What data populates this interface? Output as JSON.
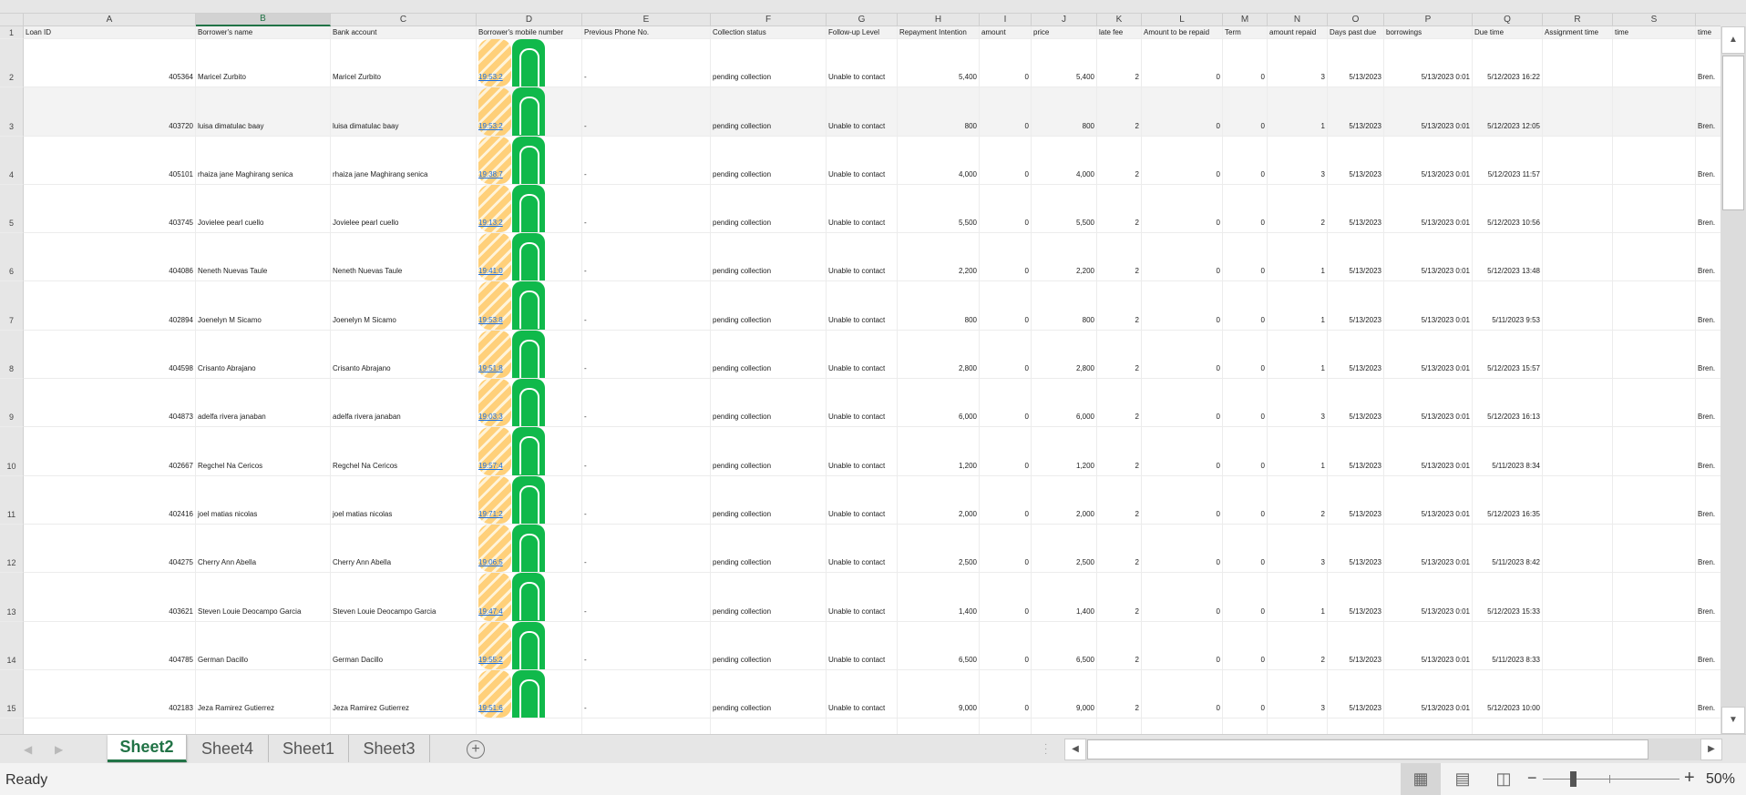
{
  "columns": [
    "A",
    "B",
    "C",
    "D",
    "E",
    "F",
    "G",
    "H",
    "I",
    "J",
    "K",
    "L",
    "M",
    "N",
    "O",
    "P",
    "Q",
    "R",
    "S",
    ""
  ],
  "selected_column": "B",
  "headers": [
    "Loan ID",
    "Borrower's name",
    "Bank account",
    "Borrower's mobile number",
    "Previous Phone No.",
    "Collection status",
    "Follow-up Level",
    "Repayment Intention",
    "amount",
    "price",
    "late fee",
    "Amount to be repaid",
    "Term",
    "amount repaid",
    "Days past due",
    "borrowings",
    "Due time",
    "Assignment time",
    "time",
    "time"
  ],
  "rows": [
    {
      "n": "2",
      "id": "405364",
      "name": "Maricel Zurbito",
      "bank": "Maricel Zurbito",
      "phone": "19:53:2",
      "prev": "-",
      "status": "pending collection",
      "follow": "Unable to contact",
      "intent": "5,400",
      "amount": "0",
      "price": "5,400",
      "late": "2",
      "tobe": "0",
      "term": "0",
      "repaid": "3",
      "dpd": "5/13/2023",
      "borrow": "5/13/2023 0:01",
      "due": "5/12/2023 16:22",
      "assign": "",
      "time": "",
      "time2": "Bren."
    },
    {
      "n": "3",
      "id": "403720",
      "name": "luisa dimatulac baay",
      "bank": "luisa dimatulac baay",
      "phone": "19:53:2",
      "prev": "-",
      "status": "pending collection",
      "follow": "Unable to contact",
      "intent": "800",
      "amount": "0",
      "price": "800",
      "late": "2",
      "tobe": "0",
      "term": "0",
      "repaid": "1",
      "dpd": "5/13/2023",
      "borrow": "5/13/2023 0:01",
      "due": "5/12/2023 12:05",
      "assign": "",
      "time": "",
      "time2": "Bren."
    },
    {
      "n": "4",
      "id": "405101",
      "name": "rhaiza jane Maghirang senica",
      "bank": "rhaiza jane Maghirang senica",
      "phone": "19:38:7",
      "prev": "-",
      "status": "pending collection",
      "follow": "Unable to contact",
      "intent": "4,000",
      "amount": "0",
      "price": "4,000",
      "late": "2",
      "tobe": "0",
      "term": "0",
      "repaid": "3",
      "dpd": "5/13/2023",
      "borrow": "5/13/2023 0:01",
      "due": "5/12/2023 11:57",
      "assign": "",
      "time": "",
      "time2": "Bren."
    },
    {
      "n": "5",
      "id": "403745",
      "name": "Jovielee pearl cuello",
      "bank": "Jovielee pearl cuello",
      "phone": "19:13:2",
      "prev": "-",
      "status": "pending collection",
      "follow": "Unable to contact",
      "intent": "5,500",
      "amount": "0",
      "price": "5,500",
      "late": "2",
      "tobe": "0",
      "term": "0",
      "repaid": "2",
      "dpd": "5/13/2023",
      "borrow": "5/13/2023 0:01",
      "due": "5/12/2023 10:56",
      "assign": "",
      "time": "",
      "time2": "Bren."
    },
    {
      "n": "6",
      "id": "404086",
      "name": "Neneth Nuevas Taule",
      "bank": "Neneth Nuevas Taule",
      "phone": "19:41:0",
      "prev": "-",
      "status": "pending collection",
      "follow": "Unable to contact",
      "intent": "2,200",
      "amount": "0",
      "price": "2,200",
      "late": "2",
      "tobe": "0",
      "term": "0",
      "repaid": "1",
      "dpd": "5/13/2023",
      "borrow": "5/13/2023 0:01",
      "due": "5/12/2023 13:48",
      "assign": "",
      "time": "",
      "time2": "Bren."
    },
    {
      "n": "7",
      "id": "402894",
      "name": "Joenelyn M Sicamo",
      "bank": "Joenelyn M Sicamo",
      "phone": "19:53:8",
      "prev": "-",
      "status": "pending collection",
      "follow": "Unable to contact",
      "intent": "800",
      "amount": "0",
      "price": "800",
      "late": "2",
      "tobe": "0",
      "term": "0",
      "repaid": "1",
      "dpd": "5/13/2023",
      "borrow": "5/13/2023 0:01",
      "due": "5/11/2023 9:53",
      "assign": "",
      "time": "",
      "time2": "Bren."
    },
    {
      "n": "8",
      "id": "404598",
      "name": "Crisanto Abrajano",
      "bank": "Crisanto Abrajano",
      "phone": "19:51:8",
      "prev": "-",
      "status": "pending collection",
      "follow": "Unable to contact",
      "intent": "2,800",
      "amount": "0",
      "price": "2,800",
      "late": "2",
      "tobe": "0",
      "term": "0",
      "repaid": "1",
      "dpd": "5/13/2023",
      "borrow": "5/13/2023 0:01",
      "due": "5/12/2023 15:57",
      "assign": "",
      "time": "",
      "time2": "Bren."
    },
    {
      "n": "9",
      "id": "404873",
      "name": "adelfa rivera janaban",
      "bank": "adelfa rivera janaban",
      "phone": "19:03:3",
      "prev": "-",
      "status": "pending collection",
      "follow": "Unable to contact",
      "intent": "6,000",
      "amount": "0",
      "price": "6,000",
      "late": "2",
      "tobe": "0",
      "term": "0",
      "repaid": "3",
      "dpd": "5/13/2023",
      "borrow": "5/13/2023 0:01",
      "due": "5/12/2023 16:13",
      "assign": "",
      "time": "",
      "time2": "Bren."
    },
    {
      "n": "10",
      "id": "402667",
      "name": "Regchel Na Cericos",
      "bank": "Regchel Na Cericos",
      "phone": "19:57:4",
      "prev": "-",
      "status": "pending collection",
      "follow": "Unable to contact",
      "intent": "1,200",
      "amount": "0",
      "price": "1,200",
      "late": "2",
      "tobe": "0",
      "term": "0",
      "repaid": "1",
      "dpd": "5/13/2023",
      "borrow": "5/13/2023 0:01",
      "due": "5/11/2023 8:34",
      "assign": "",
      "time": "",
      "time2": "Bren."
    },
    {
      "n": "11",
      "id": "402416",
      "name": "joel matias nicolas",
      "bank": "joel matias nicolas",
      "phone": "19:71:2",
      "prev": "-",
      "status": "pending collection",
      "follow": "Unable to contact",
      "intent": "2,000",
      "amount": "0",
      "price": "2,000",
      "late": "2",
      "tobe": "0",
      "term": "0",
      "repaid": "2",
      "dpd": "5/13/2023",
      "borrow": "5/13/2023 0:01",
      "due": "5/12/2023 16:35",
      "assign": "",
      "time": "",
      "time2": "Bren."
    },
    {
      "n": "12",
      "id": "404275",
      "name": "Cherry Ann Abella",
      "bank": "Cherry Ann Abella",
      "phone": "19:06:5",
      "prev": "-",
      "status": "pending collection",
      "follow": "Unable to contact",
      "intent": "2,500",
      "amount": "0",
      "price": "2,500",
      "late": "2",
      "tobe": "0",
      "term": "0",
      "repaid": "3",
      "dpd": "5/13/2023",
      "borrow": "5/13/2023 0:01",
      "due": "5/11/2023 8:42",
      "assign": "",
      "time": "",
      "time2": "Bren."
    },
    {
      "n": "13",
      "id": "403621",
      "name": "Steven Louie Deocampo Garcia",
      "bank": "Steven Louie Deocampo Garcia",
      "phone": "19:47:4",
      "prev": "-",
      "status": "pending collection",
      "follow": "Unable to contact",
      "intent": "1,400",
      "amount": "0",
      "price": "1,400",
      "late": "2",
      "tobe": "0",
      "term": "0",
      "repaid": "1",
      "dpd": "5/13/2023",
      "borrow": "5/13/2023 0:01",
      "due": "5/12/2023 15:33",
      "assign": "",
      "time": "",
      "time2": "Bren."
    },
    {
      "n": "14",
      "id": "404785",
      "name": "German Dacillo",
      "bank": "German Dacillo",
      "phone": "19:55:2",
      "prev": "-",
      "status": "pending collection",
      "follow": "Unable to contact",
      "intent": "6,500",
      "amount": "0",
      "price": "6,500",
      "late": "2",
      "tobe": "0",
      "term": "0",
      "repaid": "2",
      "dpd": "5/13/2023",
      "borrow": "5/13/2023 0:01",
      "due": "5/11/2023 8:33",
      "assign": "",
      "time": "",
      "time2": "Bren."
    },
    {
      "n": "15",
      "id": "402183",
      "name": "Jeza Ramirez Gutierrez",
      "bank": "Jeza Ramirez Gutierrez",
      "phone": "19:51:6",
      "prev": "-",
      "status": "pending collection",
      "follow": "Unable to contact",
      "intent": "9,000",
      "amount": "0",
      "price": "9,000",
      "late": "2",
      "tobe": "0",
      "term": "0",
      "repaid": "3",
      "dpd": "5/13/2023",
      "borrow": "5/13/2023 0:01",
      "due": "5/12/2023 10:00",
      "assign": "",
      "time": "",
      "time2": "Bren."
    }
  ],
  "sheet_tabs": [
    {
      "label": "Sheet2",
      "active": true
    },
    {
      "label": "Sheet4",
      "active": false
    },
    {
      "label": "Sheet1",
      "active": false
    },
    {
      "label": "Sheet3",
      "active": false
    }
  ],
  "add_sheet_label": "+",
  "status": {
    "text": "Ready",
    "zoom": "50%",
    "zoom_minus": "−",
    "zoom_plus": "+"
  },
  "colors": {
    "accent": "#217346",
    "link": "#1a6ee0",
    "icon_orange": "#ffcb6b",
    "icon_green": "#10b94b"
  }
}
